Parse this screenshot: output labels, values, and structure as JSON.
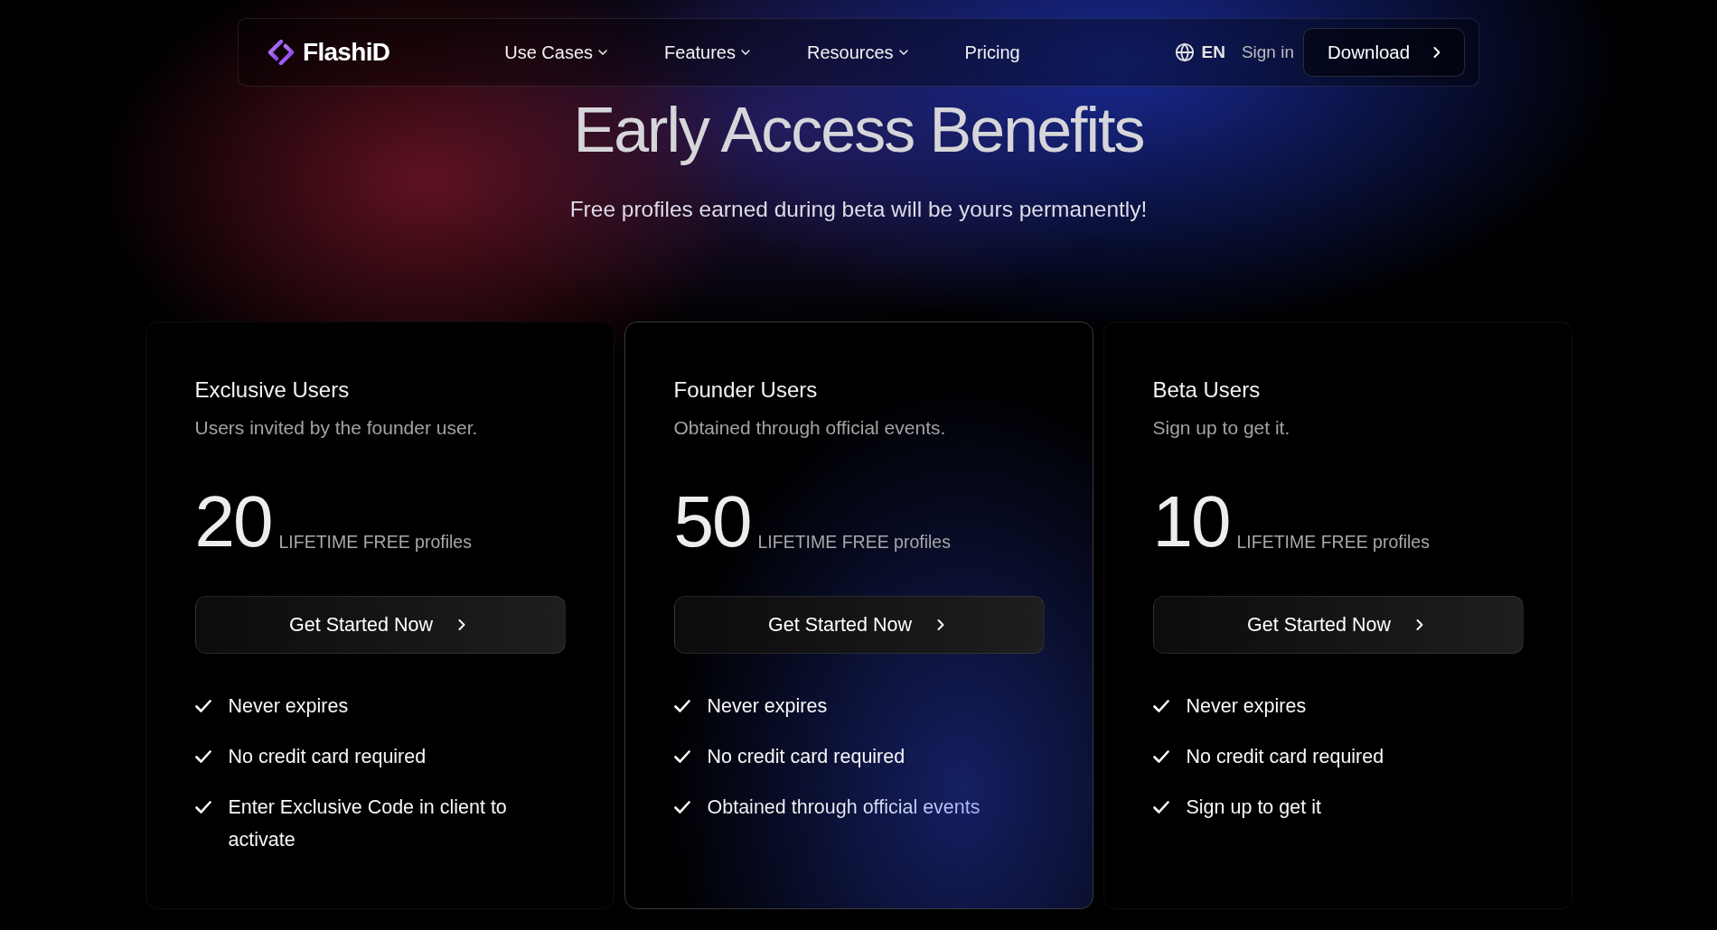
{
  "nav": {
    "logo": "FlashiD",
    "links": [
      {
        "label": "Use Cases",
        "dropdown": true
      },
      {
        "label": "Features",
        "dropdown": true
      },
      {
        "label": "Resources",
        "dropdown": true
      },
      {
        "label": "Pricing",
        "dropdown": false
      }
    ],
    "language": "EN",
    "sign_in": "Sign in",
    "download": "Download"
  },
  "hero": {
    "title": "Early Access Benefits",
    "subtitle": "Free profiles earned during beta will be yours permanently!"
  },
  "plans": [
    {
      "name": "Exclusive Users",
      "description": "Users invited by the founder user.",
      "count": "20",
      "count_label": "LIFETIME FREE profiles",
      "button": "Get Started Now",
      "highlighted": false,
      "features": [
        {
          "text": "Never expires",
          "accent": false
        },
        {
          "text": "No credit card required",
          "accent": false
        },
        {
          "text": "Enter Exclusive Code in client to activate",
          "accent": false
        }
      ]
    },
    {
      "name": "Founder Users",
      "description": "Obtained through official events.",
      "count": "50",
      "count_label": "LIFETIME FREE profiles",
      "button": "Get Started Now",
      "highlighted": true,
      "features": [
        {
          "text": "Never expires",
          "accent": false
        },
        {
          "text": "No credit card required",
          "accent": false
        },
        {
          "text": "Obtained through official events",
          "accent": true
        }
      ]
    },
    {
      "name": "Beta Users",
      "description": "Sign up to get it.",
      "count": "10",
      "count_label": "LIFETIME FREE profiles",
      "button": "Get Started Now",
      "highlighted": false,
      "features": [
        {
          "text": "Never expires",
          "accent": false
        },
        {
          "text": "No credit card required",
          "accent": false
        },
        {
          "text": "Sign up to get it",
          "accent": false
        }
      ]
    }
  ]
}
